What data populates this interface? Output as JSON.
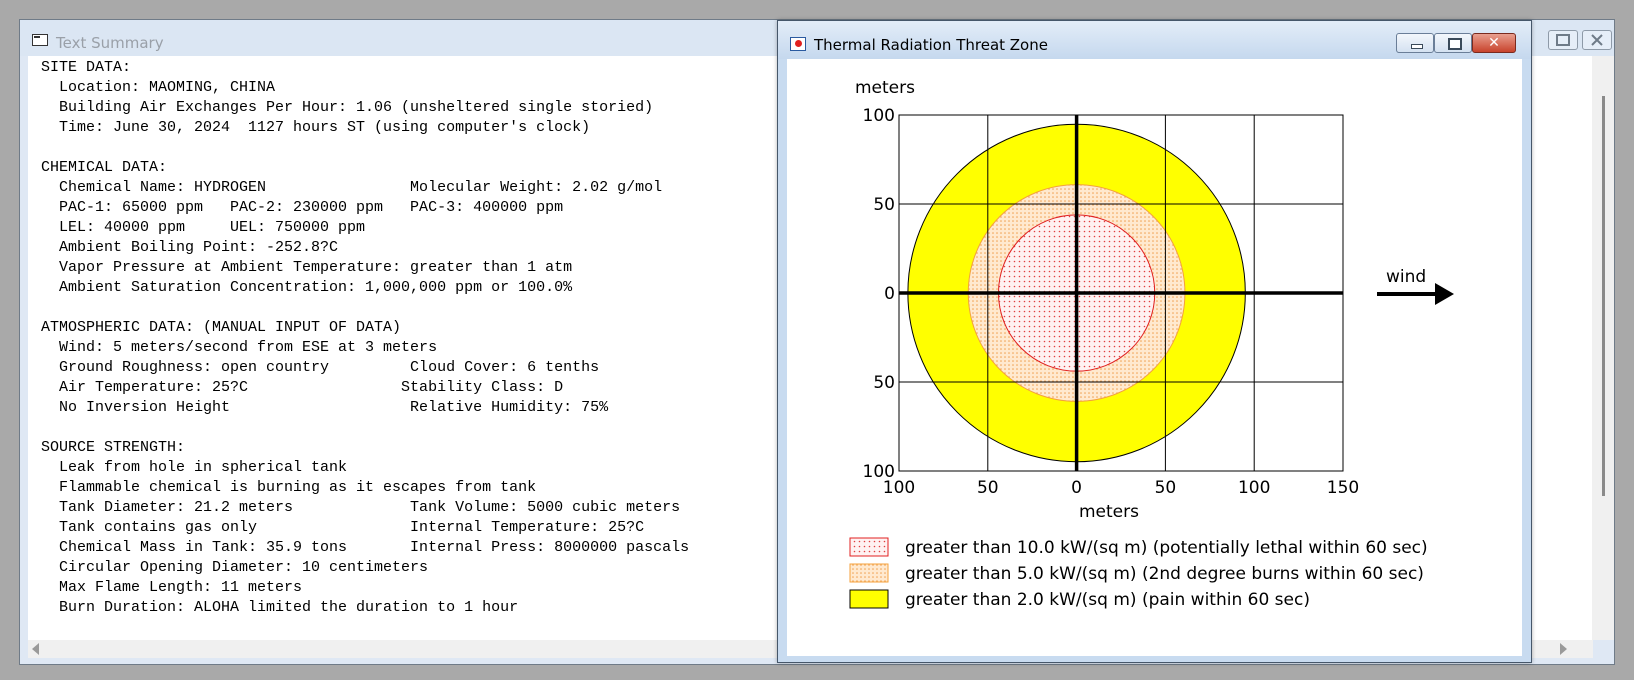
{
  "back_window": {
    "title": "Text Summary",
    "summary_lines": [
      "SITE DATA:",
      "  Location: MAOMING, CHINA",
      "  Building Air Exchanges Per Hour: 1.06 (unsheltered single storied)",
      "  Time: June 30, 2024  1127 hours ST (using computer's clock)",
      "",
      "CHEMICAL DATA:",
      "  Chemical Name: HYDROGEN                Molecular Weight: 2.02 g/mol",
      "  PAC-1: 65000 ppm   PAC-2: 230000 ppm   PAC-3: 400000 ppm",
      "  LEL: 40000 ppm     UEL: 750000 ppm",
      "  Ambient Boiling Point: -252.8?C",
      "  Vapor Pressure at Ambient Temperature: greater than 1 atm",
      "  Ambient Saturation Concentration: 1,000,000 ppm or 100.0%",
      "",
      "ATMOSPHERIC DATA: (MANUAL INPUT OF DATA)",
      "  Wind: 5 meters/second from ESE at 3 meters",
      "  Ground Roughness: open country         Cloud Cover: 6 tenths",
      "  Air Temperature: 25?C                 Stability Class: D",
      "  No Inversion Height                    Relative Humidity: 75%",
      "",
      "SOURCE STRENGTH:",
      "  Leak from hole in spherical tank",
      "  Flammable chemical is burning as it escapes from tank",
      "  Tank Diameter: 21.2 meters             Tank Volume: 5000 cubic meters",
      "  Tank contains gas only                 Internal Temperature: 25?C",
      "  Chemical Mass in Tank: 35.9 tons       Internal Press: 8000000 pascals",
      "  Circular Opening Diameter: 10 centimeters",
      "  Max Flame Length: 11 meters",
      "  Burn Duration: ALOHA limited the duration to 1 hour"
    ]
  },
  "front_window": {
    "title": "Thermal Radiation Threat Zone"
  },
  "chart_data": {
    "type": "threat-zone-plot",
    "x_axis": {
      "label": "meters",
      "range": [
        -100,
        150
      ],
      "ticks": [
        -100,
        -50,
        0,
        50,
        100,
        150
      ],
      "tick_labels": [
        "100",
        "50",
        "0",
        "50",
        "100",
        "150"
      ]
    },
    "y_axis": {
      "label": "meters",
      "range": [
        -100,
        100
      ],
      "ticks": [
        100,
        50,
        0,
        -50,
        -100
      ],
      "tick_labels": [
        "100",
        "50",
        "0",
        "50",
        "100"
      ]
    },
    "grid": true,
    "wind": {
      "label": "wind",
      "direction": "east"
    },
    "zones": [
      {
        "name": "greater than 2.0 kW/(sq m) (pain within 60 sec)",
        "radius_m": 95,
        "fill": "#ffff00",
        "stroke": "#000000",
        "pattern": "solid"
      },
      {
        "name": "greater than 5.0 kW/(sq m) (2nd degree burns within 60 sec)",
        "radius_m": 61,
        "fill": "#ffe3c2",
        "stroke": "#f4a23c",
        "pattern": "dots"
      },
      {
        "name": "greater than 10.0 kW/(sq m) (potentially lethal within 60 sec)",
        "radius_m": 44,
        "fill": "#fff0f0",
        "stroke": "#e02020",
        "pattern": "dots"
      }
    ],
    "legend": [
      {
        "label": "greater than 10.0 kW/(sq m) (potentially lethal within 60 sec)",
        "swatch": "red-dots"
      },
      {
        "label": "greater than 5.0 kW/(sq m) (2nd degree burns within 60 sec)",
        "swatch": "orange-dots"
      },
      {
        "label": "greater than 2.0 kW/(sq m) (pain within 60 sec)",
        "swatch": "yellow-solid"
      }
    ]
  }
}
